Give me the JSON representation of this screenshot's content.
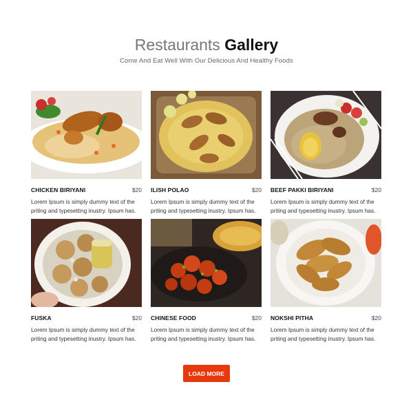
{
  "header": {
    "title_light": "Restaurants",
    "title_bold": "Gallery",
    "subtitle": "Come And Eat Well With Our Delicious And Healthy Foods"
  },
  "items": [
    {
      "name": "CHICKEN BIRIYANI",
      "price": "$20",
      "description": "Lorem Ipsum is simply dummy text of the priting and typesetting inustry. Ipsum has."
    },
    {
      "name": "ILISH POLAO",
      "price": "$20",
      "description": "Lorem Ipsum is simply dummy text of the priting and typesetting inustry. Ipsum has."
    },
    {
      "name": "BEEF PAKKI BIRIYANI",
      "price": "$20",
      "description": "Lorem Ipsum is simply dummy text of the priting and typesetting inustry. Ipsum has."
    },
    {
      "name": "FUSKA",
      "price": "$20",
      "description": "Lorem Ipsum is simply dummy text of the priting and typesetting inustry. Ipsum has."
    },
    {
      "name": "CHINESE FOOD",
      "price": "$20",
      "description": "Lorem Ipsum is simply dummy text of the priting and typesetting inustry. Ipsum has."
    },
    {
      "name": "NOKSHI PITHA",
      "price": "$20",
      "description": "Lorem Ipsum is simply dummy text of the priting and typesetting inustry. Ipsum has."
    }
  ],
  "load_more_label": "LOAD MORE",
  "colors": {
    "accent": "#e8380d",
    "title_light": "#777777",
    "title_dark": "#111111"
  }
}
